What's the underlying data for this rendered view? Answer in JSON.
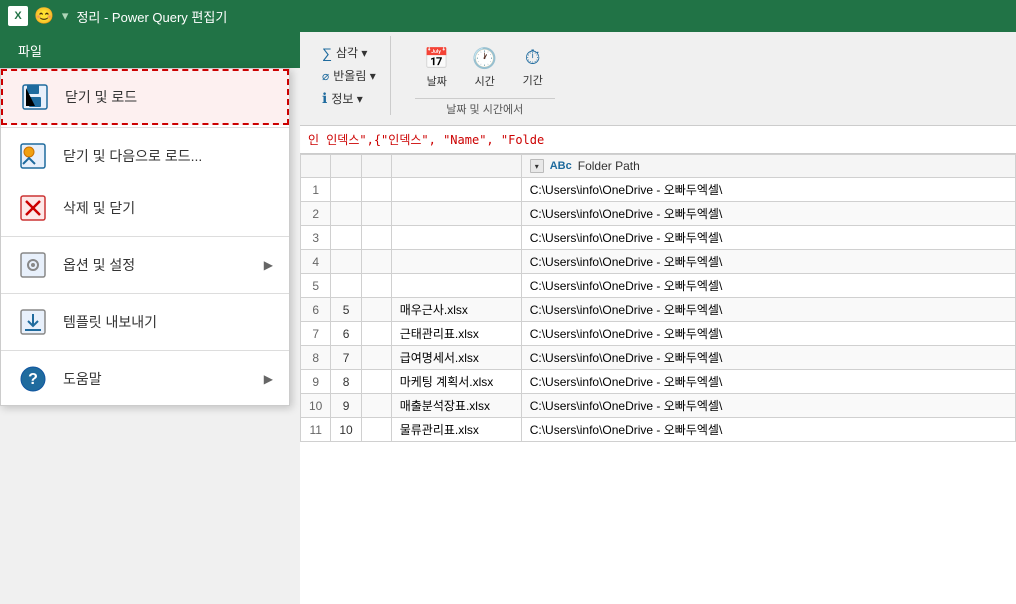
{
  "titleBar": {
    "excelLabel": "X",
    "smiley": "😊",
    "separator": "▾",
    "title": "정리 - Power Query 편집기"
  },
  "fileMenu": {
    "tabLabel": "파일",
    "items": [
      {
        "id": "close-load",
        "label": "닫기 및 로드",
        "icon": "save",
        "highlighted": true,
        "hasArrow": false
      },
      {
        "id": "close-load-to",
        "label": "닫기 및 다음으로 로드...",
        "icon": "save-as",
        "highlighted": false,
        "hasArrow": false
      },
      {
        "id": "delete-close",
        "label": "삭제 및 닫기",
        "icon": "delete",
        "highlighted": false,
        "hasArrow": false
      },
      {
        "id": "options-settings",
        "label": "옵션 및 설정",
        "icon": "settings",
        "highlighted": false,
        "hasArrow": true
      },
      {
        "id": "export-template",
        "label": "템플릿 내보내기",
        "icon": "export",
        "highlighted": false,
        "hasArrow": false
      },
      {
        "id": "help",
        "label": "도움말",
        "icon": "help",
        "highlighted": false,
        "hasArrow": true
      }
    ]
  },
  "ribbon": {
    "groups": [
      {
        "id": "datetime-calc",
        "buttons": [
          {
            "id": "sum",
            "label": "삼각▾",
            "icon": "∑"
          },
          {
            "id": "round",
            "label": "반올림▾",
            "icon": "⌀"
          },
          {
            "id": "info",
            "label": "정보▾",
            "icon": "ℹ"
          }
        ],
        "title": ""
      },
      {
        "id": "datetime-group",
        "buttons": [
          {
            "id": "date-btn",
            "label": "날짜",
            "icon": "📅"
          },
          {
            "id": "time-btn",
            "label": "시간",
            "icon": "🕐"
          },
          {
            "id": "duration-btn",
            "label": "기간",
            "icon": "⏱"
          }
        ],
        "title": "날짜 및 시간에서"
      }
    ]
  },
  "formulaBar": {
    "text": "인 인덱스\",{\"인덱스\", \"Name\", \"Folde"
  },
  "table": {
    "columns": [
      {
        "id": "row-num",
        "label": ""
      },
      {
        "id": "idx",
        "label": ""
      },
      {
        "id": "num",
        "label": ""
      },
      {
        "id": "name",
        "label": ""
      },
      {
        "id": "folder-path",
        "label": "Folder Path",
        "type": "ABC"
      }
    ],
    "rows": [
      {
        "rowNum": 6,
        "idx": 5,
        "name": "매우근사.xlsx",
        "folderPath": "C:\\Users\\info\\OneDrive - 오빠두엑셀\\"
      },
      {
        "rowNum": 7,
        "idx": 6,
        "name": "근태관리표.xlsx",
        "folderPath": "C:\\Users\\info\\OneDrive - 오빠두엑셀\\"
      },
      {
        "rowNum": 8,
        "idx": 7,
        "name": "급여명세서.xlsx",
        "folderPath": "C:\\Users\\info\\OneDrive - 오빠두엑셀\\"
      },
      {
        "rowNum": 9,
        "idx": 8,
        "name": "마케팅 계획서.xlsx",
        "folderPath": "C:\\Users\\info\\OneDrive - 오빠두엑셀\\"
      },
      {
        "rowNum": 10,
        "idx": 9,
        "name": "매출분석장표.xlsx",
        "folderPath": "C:\\Users\\info\\OneDrive - 오빠두엑셀\\"
      },
      {
        "rowNum": 11,
        "idx": 10,
        "name": "물류관리표.xlsx",
        "folderPath": "C:\\Users\\info\\OneDrive - 오빠두엑셀\\"
      }
    ]
  },
  "partialRows": [
    {
      "rowNum": 1,
      "folderPath": "C:\\Users\\info\\OneDrive - 오빠두엑셀\\"
    },
    {
      "rowNum": 2,
      "folderPath": "C:\\Users\\info\\OneDrive - 오빠두엑셀\\"
    },
    {
      "rowNum": 3,
      "folderPath": "C:\\Users\\info\\OneDrive - 오빠두엑셀\\"
    },
    {
      "rowNum": 4,
      "folderPath": "C:\\Users\\info\\OneDrive - 오빠두엑셀\\"
    },
    {
      "rowNum": 5,
      "folderPath": "C:\\Users\\info\\OneDrive - 오빠두엑셀\\"
    }
  ]
}
